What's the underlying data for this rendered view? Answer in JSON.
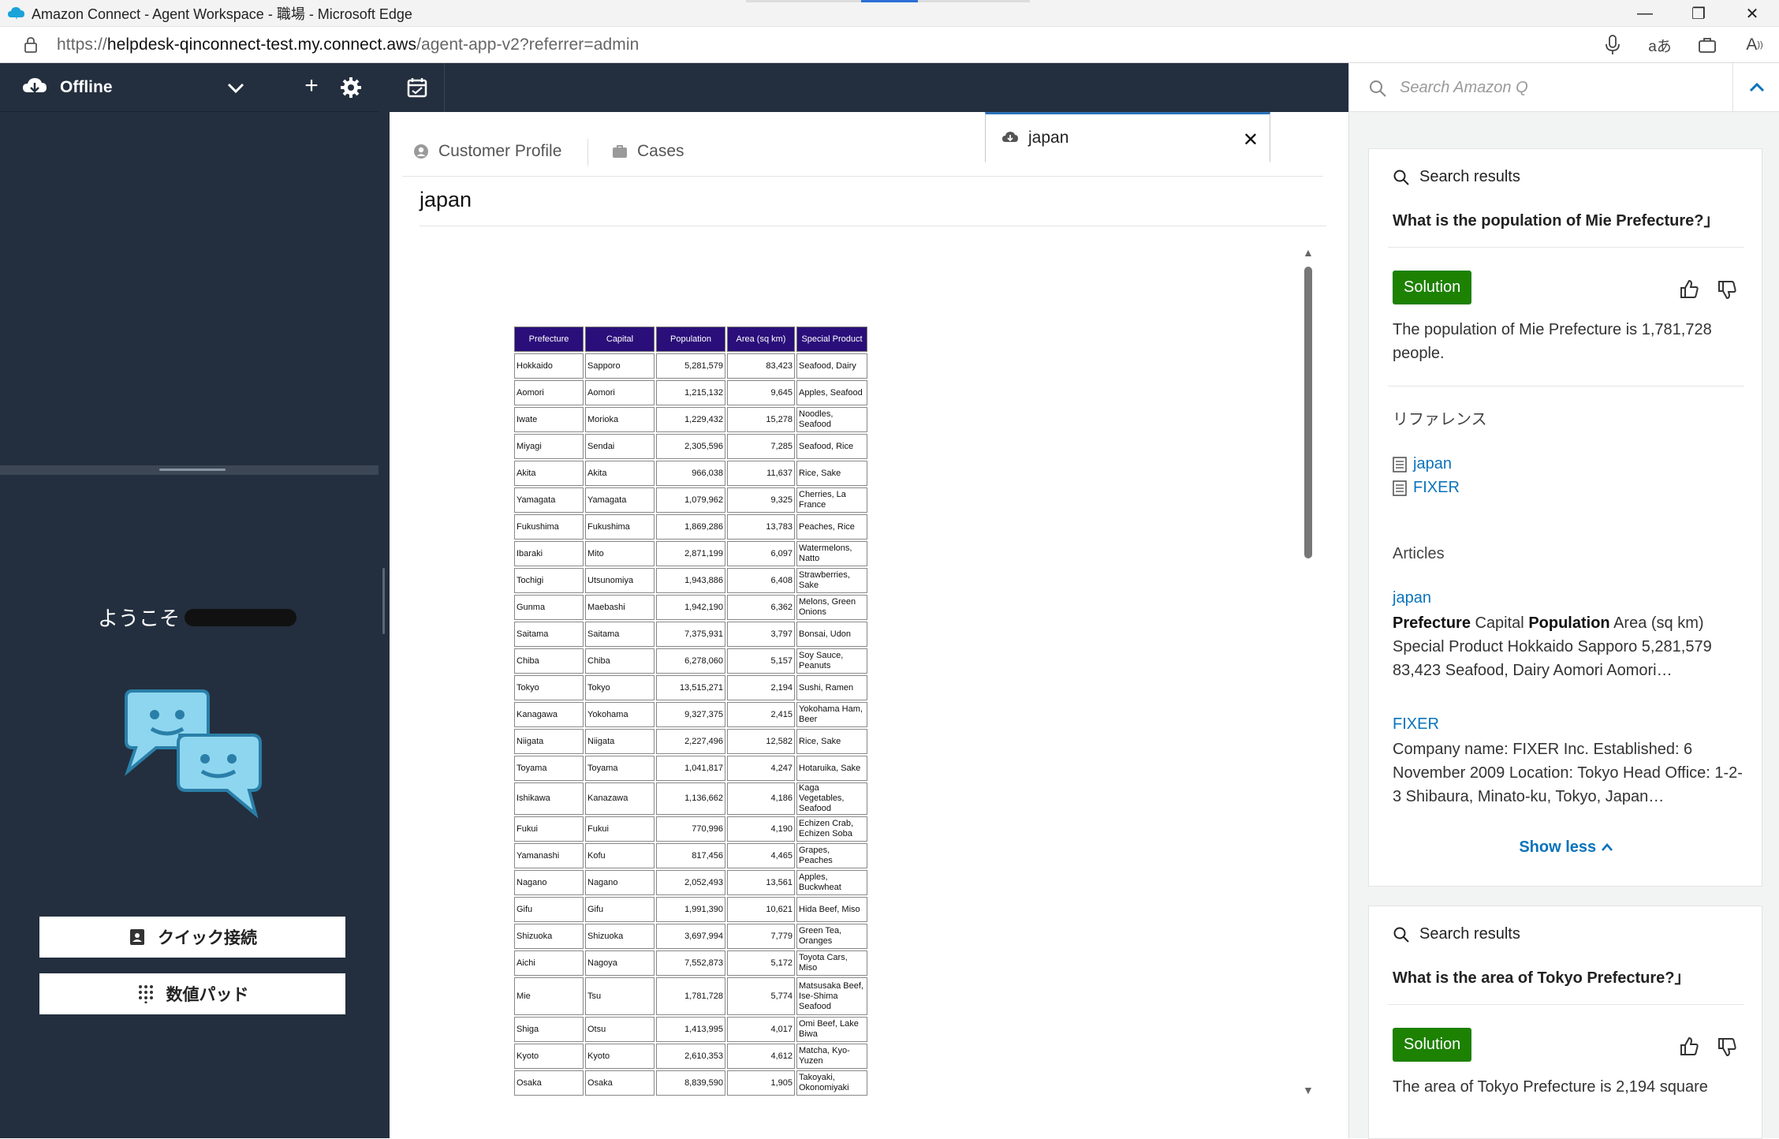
{
  "browser": {
    "title": "Amazon Connect - Agent Workspace - 職場 - Microsoft Edge",
    "url_prefix": "https://",
    "url_host": "helpdesk-qinconnect-test.my.connect.aws",
    "url_path": "/agent-app-v2?referrer=admin"
  },
  "agent": {
    "status": "Offline",
    "welcome": "ようこそ",
    "quick_connect": "クイック接続",
    "number_pad": "数値パッド"
  },
  "tabs": [
    {
      "label": "Customer Profile"
    },
    {
      "label": "Cases"
    },
    {
      "label": "japan"
    }
  ],
  "document": {
    "title": "japan",
    "table": {
      "headers": [
        "Prefecture",
        "Capital",
        "Population",
        "Area (sq km)",
        "Special Product"
      ],
      "rows": [
        [
          "Hokkaido",
          "Sapporo",
          "5,281,579",
          "83,423",
          "Seafood, Dairy"
        ],
        [
          "Aomori",
          "Aomori",
          "1,215,132",
          "9,645",
          "Apples, Seafood"
        ],
        [
          "Iwate",
          "Morioka",
          "1,229,432",
          "15,278",
          "Noodles, Seafood"
        ],
        [
          "Miyagi",
          "Sendai",
          "2,305,596",
          "7,285",
          "Seafood, Rice"
        ],
        [
          "Akita",
          "Akita",
          "966,038",
          "11,637",
          "Rice, Sake"
        ],
        [
          "Yamagata",
          "Yamagata",
          "1,079,962",
          "9,325",
          "Cherries, La France"
        ],
        [
          "Fukushima",
          "Fukushima",
          "1,869,286",
          "13,783",
          "Peaches, Rice"
        ],
        [
          "Ibaraki",
          "Mito",
          "2,871,199",
          "6,097",
          "Watermelons, Natto"
        ],
        [
          "Tochigi",
          "Utsunomiya",
          "1,943,886",
          "6,408",
          "Strawberries, Sake"
        ],
        [
          "Gunma",
          "Maebashi",
          "1,942,190",
          "6,362",
          "Melons, Green Onions"
        ],
        [
          "Saitama",
          "Saitama",
          "7,375,931",
          "3,797",
          "Bonsai, Udon"
        ],
        [
          "Chiba",
          "Chiba",
          "6,278,060",
          "5,157",
          "Soy Sauce, Peanuts"
        ],
        [
          "Tokyo",
          "Tokyo",
          "13,515,271",
          "2,194",
          "Sushi, Ramen"
        ],
        [
          "Kanagawa",
          "Yokohama",
          "9,327,375",
          "2,415",
          "Yokohama Ham, Beer"
        ],
        [
          "Niigata",
          "Niigata",
          "2,227,496",
          "12,582",
          "Rice, Sake"
        ],
        [
          "Toyama",
          "Toyama",
          "1,041,817",
          "4,247",
          "Hotaruika, Sake"
        ],
        [
          "Ishikawa",
          "Kanazawa",
          "1,136,662",
          "4,186",
          "Kaga Vegetables, Seafood"
        ],
        [
          "Fukui",
          "Fukui",
          "770,996",
          "4,190",
          "Echizen Crab, Echizen Soba"
        ],
        [
          "Yamanashi",
          "Kofu",
          "817,456",
          "4,465",
          "Grapes, Peaches"
        ],
        [
          "Nagano",
          "Nagano",
          "2,052,493",
          "13,561",
          "Apples, Buckwheat"
        ],
        [
          "Gifu",
          "Gifu",
          "1,991,390",
          "10,621",
          "Hida Beef, Miso"
        ],
        [
          "Shizuoka",
          "Shizuoka",
          "3,697,994",
          "7,779",
          "Green Tea, Oranges"
        ],
        [
          "Aichi",
          "Nagoya",
          "7,552,873",
          "5,172",
          "Toyota Cars, Miso"
        ],
        [
          "Mie",
          "Tsu",
          "1,781,728",
          "5,774",
          "Matsusaka Beef, Ise-Shima Seafood"
        ],
        [
          "Shiga",
          "Otsu",
          "1,413,995",
          "4,017",
          "Omi Beef, Lake Biwa"
        ],
        [
          "Kyoto",
          "Kyoto",
          "2,610,353",
          "4,612",
          "Matcha, Kyo-Yuzen"
        ],
        [
          "Osaka",
          "Osaka",
          "8,839,590",
          "1,905",
          "Takoyaki, Okonomiyaki"
        ]
      ]
    }
  },
  "amazon_q": {
    "search_placeholder": "Search Amazon Q",
    "card1": {
      "header": "Search results",
      "question": "What is the population of Mie Prefecture?」",
      "badge": "Solution",
      "answer": "The population of Mie Prefecture is 1,781,728 people.",
      "references_label": "リファレンス",
      "references": [
        "japan",
        "FIXER"
      ],
      "articles_label": "Articles",
      "article1_title": "japan",
      "article1_text_b1": "Prefecture",
      "article1_text_1": " Capital ",
      "article1_text_b2": "Population",
      "article1_text_2": " Area (sq km) Special Product Hokkaido Sapporo 5,281,579 83,423 Seafood, Dairy Aomori Aomori…",
      "article2_title": "FIXER",
      "article2_text": "Company name: FIXER Inc. Established: 6 November 2009 Location: Tokyo Head Office: 1-2-3 Shibaura, Minato-ku, Tokyo, Japan…",
      "show_less": "Show less"
    },
    "card2": {
      "header": "Search results",
      "question": "What is the area of Tokyo Prefecture?」",
      "badge": "Solution",
      "answer": "The area of Tokyo Prefecture is 2,194 square"
    }
  }
}
